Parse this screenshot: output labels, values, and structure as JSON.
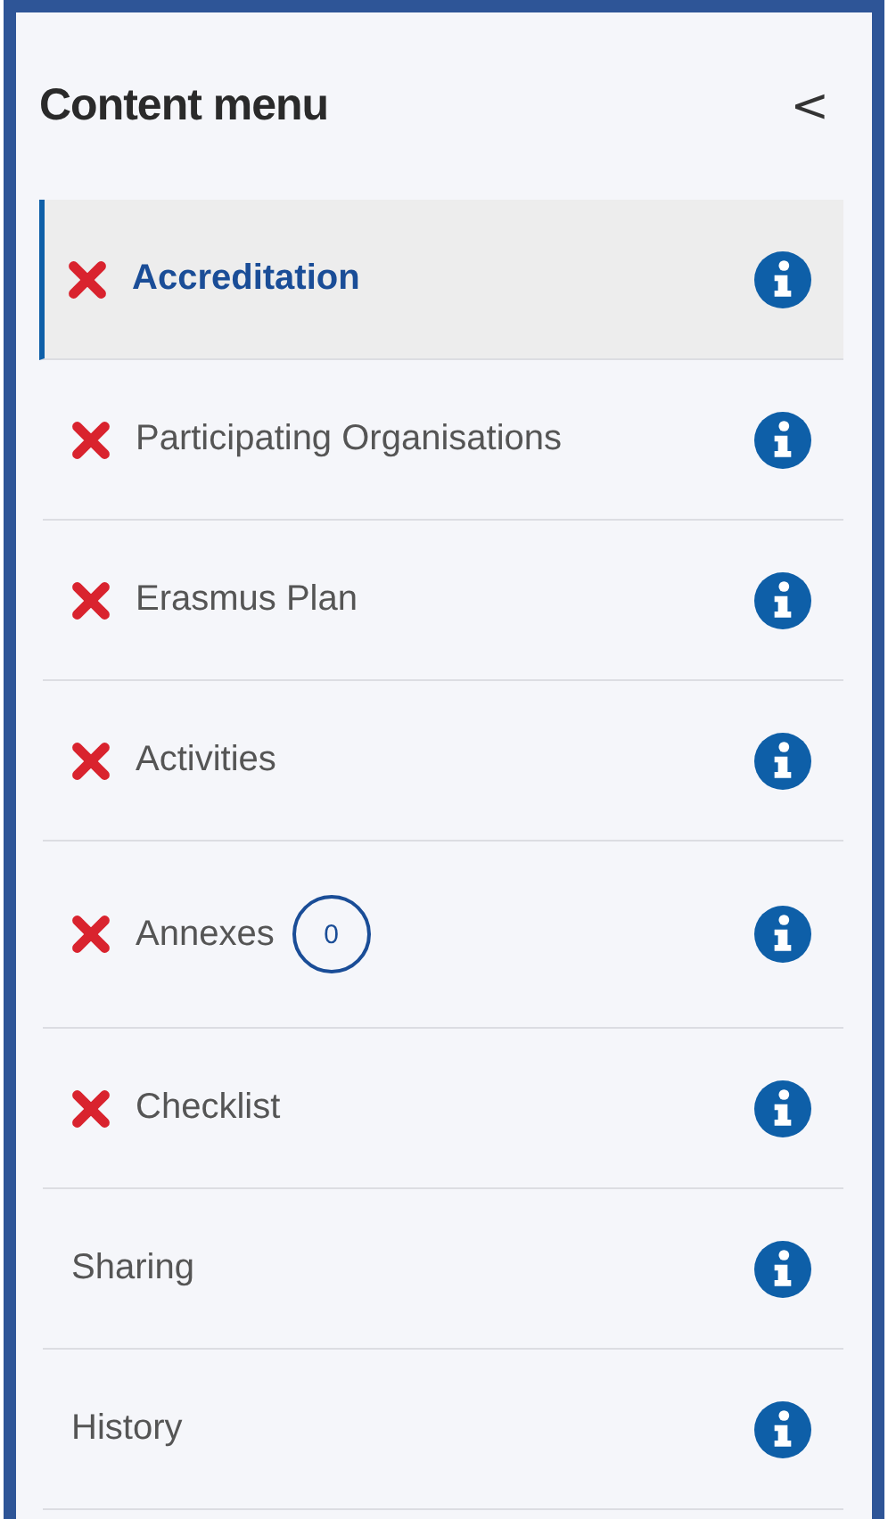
{
  "panel": {
    "title": "Content menu",
    "collapse_icon": "<"
  },
  "items": [
    {
      "label": "Accreditation",
      "selected": true,
      "error": true
    },
    {
      "label": "Participating Organisations",
      "selected": false,
      "error": true
    },
    {
      "label": "Erasmus Plan",
      "selected": false,
      "error": true
    },
    {
      "label": "Activities",
      "selected": false,
      "error": true
    },
    {
      "label": "Annexes",
      "selected": false,
      "error": true,
      "badge": "0"
    },
    {
      "label": "Checklist",
      "selected": false,
      "error": true
    },
    {
      "label": "Sharing",
      "selected": false,
      "error": false
    },
    {
      "label": "History",
      "selected": false,
      "error": false
    }
  ]
}
